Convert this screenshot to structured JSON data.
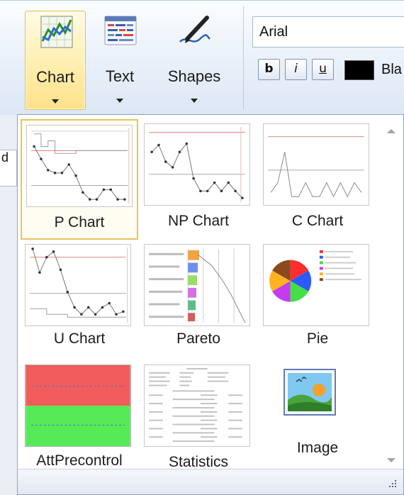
{
  "ribbon": {
    "buttons": [
      {
        "label": "Chart",
        "icon": "chart-icon",
        "active": true
      },
      {
        "label": "Text",
        "icon": "text-icon",
        "active": false
      },
      {
        "label": "Shapes",
        "icon": "pen-icon",
        "active": false
      }
    ],
    "font_name": "Arial",
    "format_buttons": [
      "b",
      "i",
      "u"
    ],
    "color_name": "Bla",
    "color_value": "#000000"
  },
  "behind_text": "d",
  "gallery": {
    "items": [
      {
        "label": "P Chart",
        "selected": true
      },
      {
        "label": "NP Chart",
        "selected": false
      },
      {
        "label": "C Chart",
        "selected": false
      },
      {
        "label": "U Chart",
        "selected": false
      },
      {
        "label": "Pareto",
        "selected": false
      },
      {
        "label": "Pie",
        "selected": false
      },
      {
        "label": "AttPrecontrol",
        "selected": false
      },
      {
        "label": "Statistics",
        "selected": false
      },
      {
        "label": "Image",
        "selected": false
      }
    ]
  },
  "colors": {
    "selection_border": "#e8c45c",
    "ribbon_active": "#ffe18a",
    "control_line": "#e07a7a",
    "center_line": "#a8a8a8",
    "series": "#8a8a8a",
    "precontrol_red": "#f25c5c",
    "precontrol_green": "#57ea57"
  }
}
